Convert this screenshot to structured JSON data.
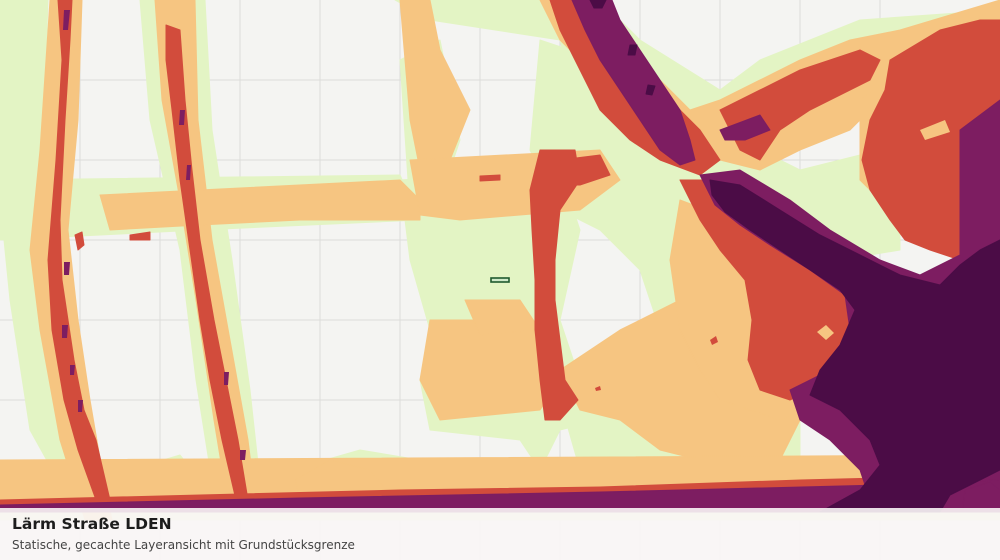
{
  "layer": {
    "title": "Lärm Straße LDEN",
    "subtitle": "Statische, gecachte Layeransicht mit Grundstücksgrenze"
  },
  "noise_palette": {
    "base": "#f4f4f2",
    "grid": "#dcdcda",
    "very_low": "#e3f4c4",
    "low": "#f6c581",
    "medium": "#d24c3c",
    "high": "#7d1d61",
    "very_high": "#4b0c46"
  },
  "property_boundary": {
    "stroke_color": "#1f5a2e",
    "fill_color": "#cfe9c8"
  }
}
